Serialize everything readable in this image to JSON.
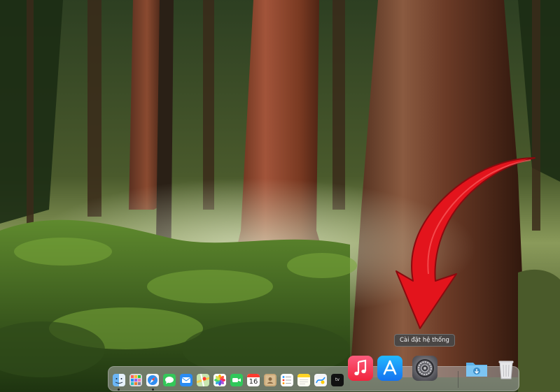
{
  "tooltip": {
    "text": "Cài đặt hệ thống"
  },
  "dock": {
    "items": [
      {
        "name": "finder",
        "icon": "finder-icon",
        "running": true
      },
      {
        "name": "launchpad",
        "icon": "launchpad-icon",
        "running": false
      },
      {
        "name": "safari",
        "icon": "safari-icon",
        "running": true
      },
      {
        "name": "messages",
        "icon": "messages-icon",
        "running": false
      },
      {
        "name": "mail",
        "icon": "mail-icon",
        "running": false
      },
      {
        "name": "maps",
        "icon": "maps-icon",
        "running": false
      },
      {
        "name": "photos",
        "icon": "photos-icon",
        "running": false
      },
      {
        "name": "facetime",
        "icon": "facetime-icon",
        "running": false
      },
      {
        "name": "calendar",
        "icon": "calendar-icon",
        "day": "16",
        "running": false
      },
      {
        "name": "contacts",
        "icon": "contacts-icon",
        "running": false
      },
      {
        "name": "reminders",
        "icon": "reminders-icon",
        "running": false
      },
      {
        "name": "notes",
        "icon": "notes-icon",
        "running": false
      },
      {
        "name": "freeform",
        "icon": "freeform-icon",
        "running": false
      },
      {
        "name": "apple-tv",
        "icon": "apple-tv-icon",
        "label": "tv",
        "running": false
      },
      {
        "name": "music",
        "icon": "music-icon",
        "running": false
      },
      {
        "name": "app-store",
        "icon": "app-store-icon",
        "running": false
      },
      {
        "name": "system-settings",
        "icon": "gear-icon",
        "running": false
      },
      {
        "name": "downloads",
        "icon": "downloads-folder-icon",
        "running": false
      },
      {
        "name": "trash",
        "icon": "trash-icon",
        "running": false
      }
    ]
  },
  "colors": {
    "arrow": "#e3141c",
    "dock_background": "#afafaf",
    "tooltip_background": "#464646"
  }
}
